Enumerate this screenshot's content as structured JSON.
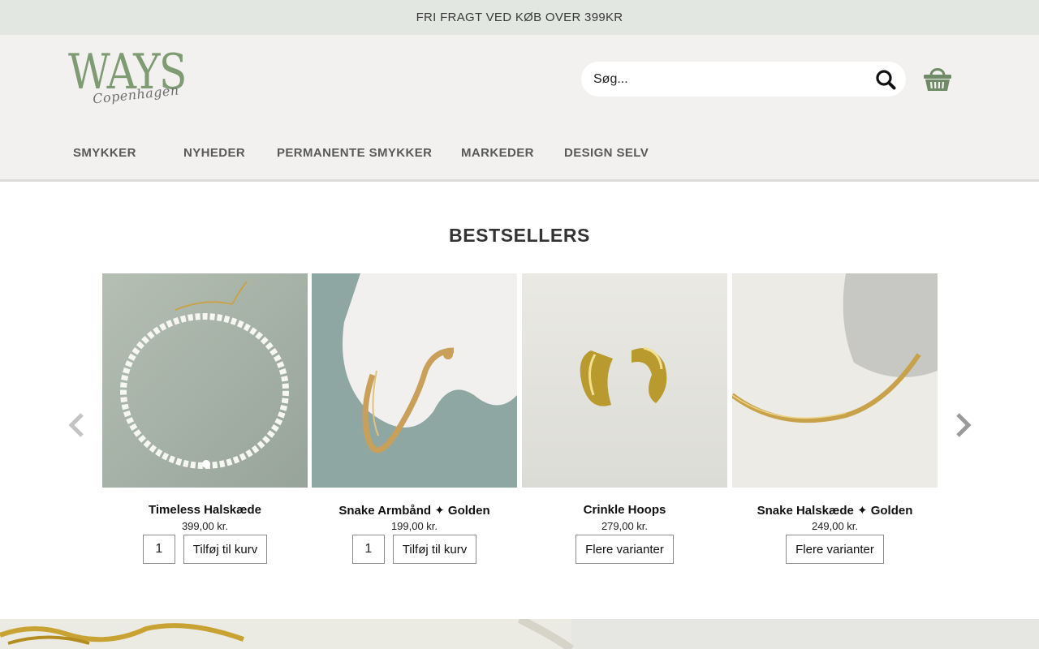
{
  "announcement": "FRI FRAGT VED KØB OVER 399KR",
  "brand": {
    "name": "WAYS",
    "tagline": "Copenhagen"
  },
  "search": {
    "placeholder": "Søg..."
  },
  "icons": {
    "search": "search-icon",
    "cart": "basket-icon",
    "prev": "chevron-left-icon",
    "next": "chevron-right-icon"
  },
  "nav": [
    {
      "label": "SMYKKER"
    },
    {
      "label": "NYHEDER"
    },
    {
      "label": "PERMANENTE SMYKKER"
    },
    {
      "label": "MARKEDER"
    },
    {
      "label": "DESIGN SELV"
    }
  ],
  "bestsellers": {
    "title": "BESTSELLERS",
    "products": [
      {
        "name": "Timeless Halskæde",
        "price": "399,00 kr.",
        "qty": "1",
        "button": "Tilføj til kurv"
      },
      {
        "name": "Snake Armbånd ✦ Golden",
        "price": "199,00 kr.",
        "qty": "1",
        "button": "Tilføj til kurv"
      },
      {
        "name": "Crinkle Hoops",
        "price": "279,00 kr.",
        "button": "Flere varianter"
      },
      {
        "name": "Snake Halskæde ✦ Golden",
        "price": "249,00 kr.",
        "button": "Flere varianter"
      }
    ]
  },
  "colors": {
    "accent": "#7f9b74",
    "topbar": "#e3e7e2",
    "header": "#f2f1ef",
    "cart": "#6f8a66"
  }
}
